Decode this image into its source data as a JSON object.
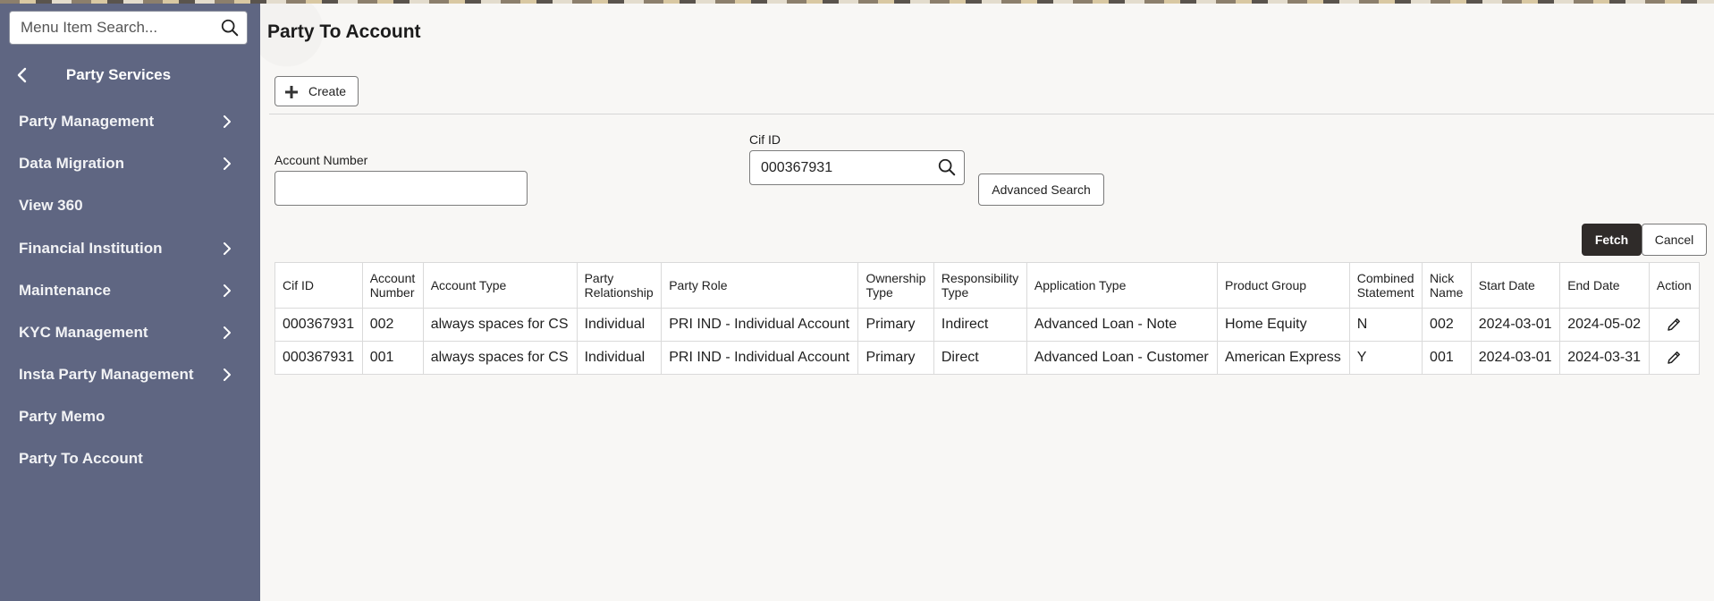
{
  "sidebar": {
    "search": {
      "placeholder": "Menu Item Search...",
      "value": ""
    },
    "section_title": "Party Services",
    "items": [
      {
        "label": "Party Management",
        "has_children": true
      },
      {
        "label": "Data Migration",
        "has_children": true
      },
      {
        "label": "View 360",
        "has_children": false
      },
      {
        "label": "Financial Institution",
        "has_children": true
      },
      {
        "label": "Maintenance",
        "has_children": true
      },
      {
        "label": "KYC Management",
        "has_children": true
      },
      {
        "label": "Insta Party Management",
        "has_children": true
      },
      {
        "label": "Party Memo",
        "has_children": false
      },
      {
        "label": "Party To Account",
        "has_children": false
      }
    ]
  },
  "page": {
    "title": "Party To Account",
    "create_label": "Create",
    "account_number": {
      "label": "Account Number",
      "value": ""
    },
    "cif_id": {
      "label": "Cif ID",
      "value": "000367931"
    },
    "advanced_search_label": "Advanced Search",
    "fetch_label": "Fetch",
    "cancel_label": "Cancel"
  },
  "table": {
    "columns": [
      [
        "Cif ID"
      ],
      [
        "Account",
        "Number"
      ],
      [
        "Account Type"
      ],
      [
        "Party",
        "Relationship"
      ],
      [
        "Party Role"
      ],
      [
        "Ownership",
        "Type"
      ],
      [
        "Responsibility",
        "Type"
      ],
      [
        "Application Type"
      ],
      [
        "Product Group"
      ],
      [
        "Combined",
        "Statement"
      ],
      [
        "Nick",
        "Name"
      ],
      [
        "Start Date"
      ],
      [
        "End Date"
      ],
      [
        "Action"
      ]
    ],
    "rows": [
      [
        "000367931",
        "002",
        "always spaces for CS",
        "Individual",
        "PRI IND - Individual Account",
        "Primary",
        "Indirect",
        "Advanced Loan - Note",
        "Home Equity",
        "N",
        "002",
        "2024-03-01",
        "2024-05-02"
      ],
      [
        "000367931",
        "001",
        "always spaces for CS",
        "Individual",
        "PRI IND - Individual Account",
        "Primary",
        "Direct",
        "Advanced Loan - Customer",
        "American Express",
        "Y",
        "001",
        "2024-03-01",
        "2024-03-31"
      ]
    ]
  },
  "icons": {
    "search": "search-icon",
    "back": "chevron-left-icon",
    "expand": "chevron-right-icon",
    "create": "plus-icon",
    "edit": "pencil-icon"
  },
  "colors": {
    "sidebar_bg": "#5f6682",
    "primary_button": "#2f2b29"
  }
}
